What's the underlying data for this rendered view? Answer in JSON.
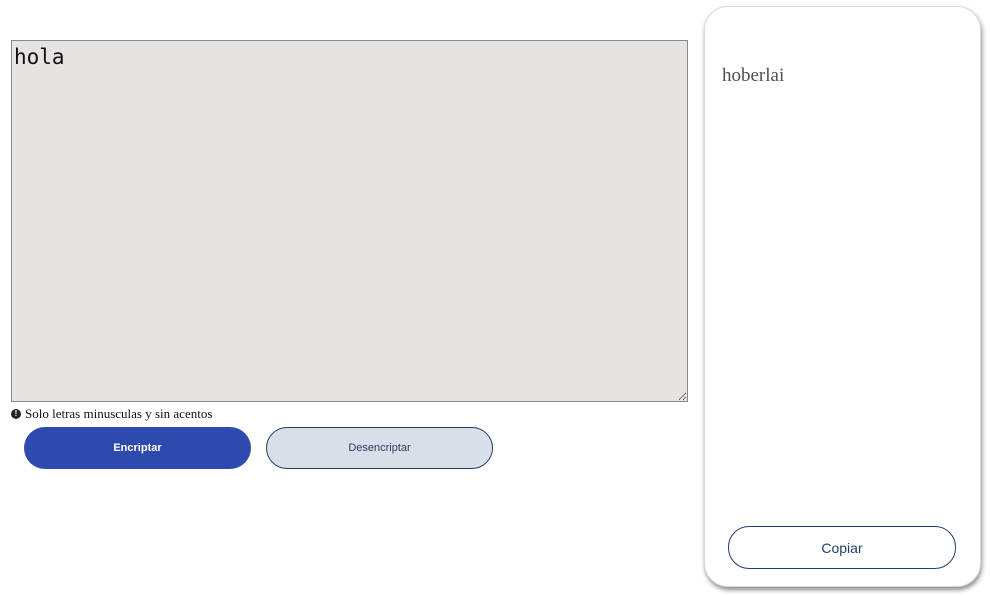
{
  "input": {
    "value": "hola"
  },
  "hint": {
    "icon": "exclamation-circle-icon",
    "text": "Solo letras minusculas y sin acentos"
  },
  "buttons": {
    "encrypt_label": "Encriptar",
    "decrypt_label": "Desencriptar"
  },
  "output": {
    "text": "hoberlai",
    "copy_label": "Copiar"
  },
  "colors": {
    "primary": "#2f4aae",
    "secondary_bg": "#d8dfe9",
    "border_dark": "#1f3f6e",
    "textarea_bg": "#e7e3e2"
  }
}
